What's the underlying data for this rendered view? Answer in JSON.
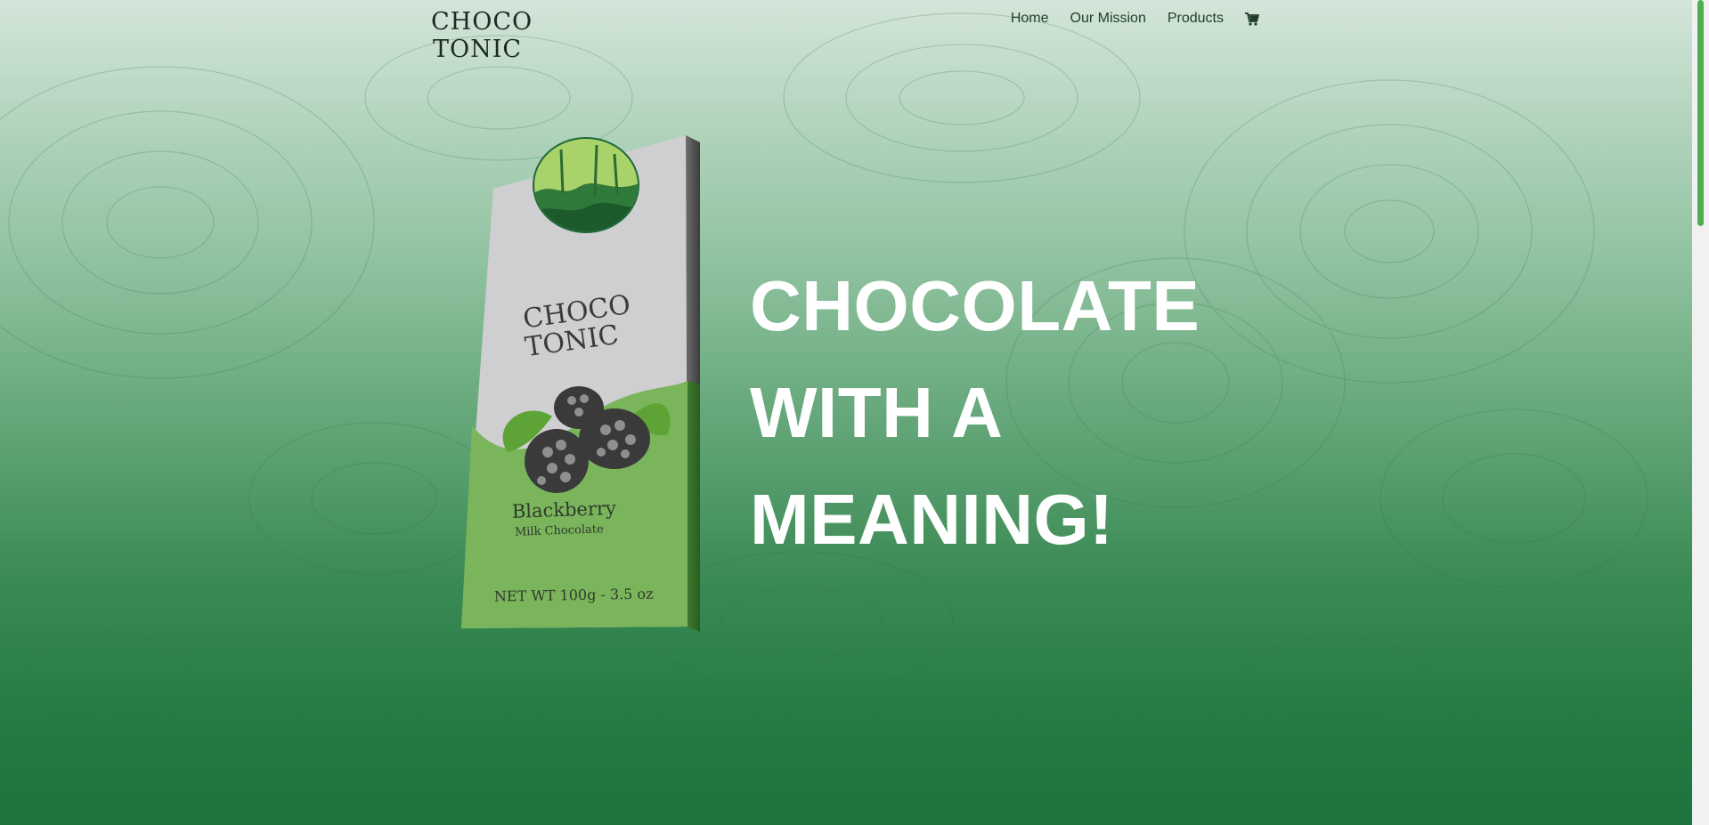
{
  "brand": {
    "logo_line1": "CHOCO",
    "logo_line2": "TONIC"
  },
  "nav": {
    "items": [
      {
        "label": "Home"
      },
      {
        "label": "Our Mission"
      },
      {
        "label": "Products"
      }
    ],
    "cart_icon": "cart-icon"
  },
  "hero": {
    "title_line1": "CHOCOLATE",
    "title_line2": "WITH A",
    "title_line3": "MEANING!"
  },
  "product": {
    "flavor": "Blackberry",
    "type": "Milk Chocolate",
    "weight": "NET WT 100g - 3.5 oz",
    "logo_line1": "CHOCO",
    "logo_line2": "TONIC"
  },
  "colors": {
    "accent": "#4caf50",
    "nav_text": "#1f3d2b",
    "hero_text": "#ffffff",
    "pack_green": "#7ab55c"
  }
}
